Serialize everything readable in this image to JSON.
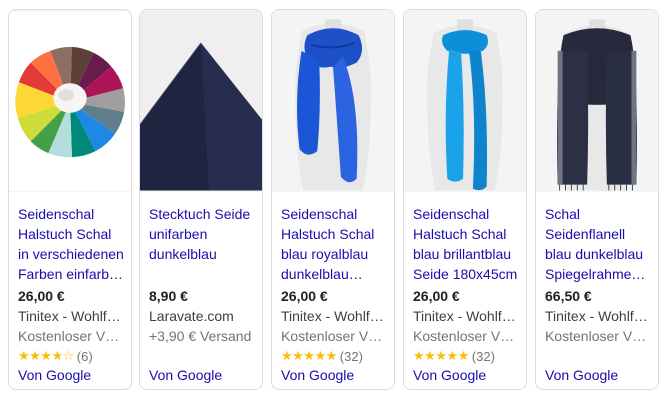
{
  "cards": [
    {
      "title_lines": [
        "Seidenschal",
        "Halstuch Schal",
        "in verschiedenen",
        "Farben einfarb…"
      ],
      "price": "26,00 €",
      "seller": "Tinitex - Wohlfü…",
      "shipping": "Kostenloser V…",
      "stars": "★★★★☆",
      "reviews": "(6)",
      "google_label": "Von Google",
      "image_icon": "color-scarf-fan-image"
    },
    {
      "title_lines": [
        "Stecktuch Seide",
        "unifarben",
        "dunkelblau",
        ""
      ],
      "price": "8,90 €",
      "seller": "Laravate.com",
      "shipping": "+3,90 € Versand",
      "stars": "",
      "reviews": "",
      "google_label": "Von Google",
      "image_icon": "pocket-square-image"
    },
    {
      "title_lines": [
        "Seidenschal",
        "Halstuch Schal",
        "blau royalblau",
        "dunkelblau…"
      ],
      "price": "26,00 €",
      "seller": "Tinitex - Wohlfü…",
      "shipping": "Kostenloser V…",
      "stars": "★★★★★",
      "reviews": "(32)",
      "google_label": "Von Google",
      "image_icon": "royal-blue-scarf-image"
    },
    {
      "title_lines": [
        "Seidenschal",
        "Halstuch Schal",
        "blau brillantblau",
        "Seide 180x45cm"
      ],
      "price": "26,00 €",
      "seller": "Tinitex - Wohlfü…",
      "shipping": "Kostenloser V…",
      "stars": "★★★★★",
      "reviews": "(32)",
      "google_label": "Von Google",
      "image_icon": "bright-blue-scarf-image"
    },
    {
      "title_lines": [
        "Schal",
        "Seidenflanell",
        "blau dunkelblau",
        "Spiegelrahme…"
      ],
      "price": "66,50 €",
      "seller": "Tinitex - Wohlfü…",
      "shipping": "Kostenloser V…",
      "stars": "",
      "reviews": "",
      "google_label": "Von Google",
      "image_icon": "dark-flannel-scarf-image"
    }
  ],
  "colors": {
    "link": "#1a0dab",
    "star": "#fbbc04",
    "border": "#dadce0"
  }
}
